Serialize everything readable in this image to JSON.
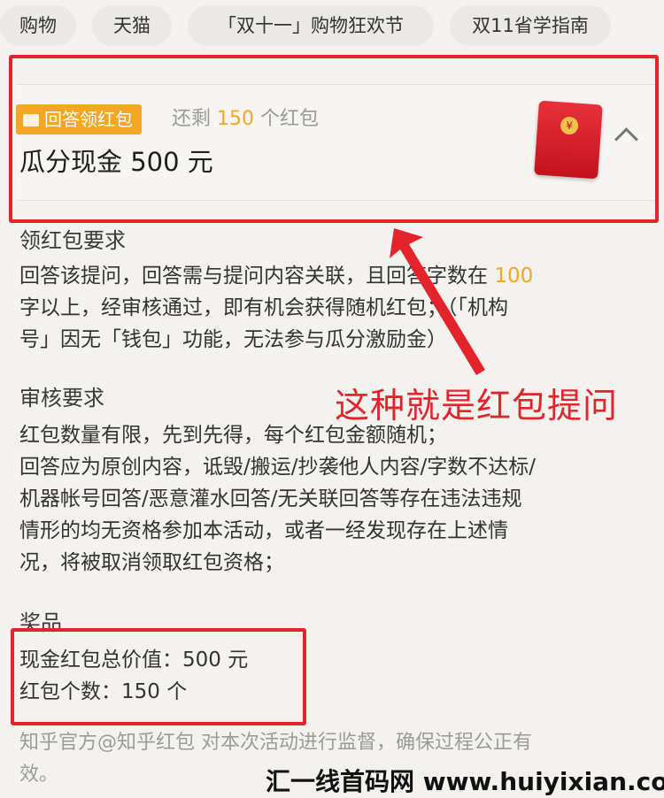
{
  "tags": [
    "购物",
    "天猫",
    "「双十一」购物狂欢节",
    "双11省学指南"
  ],
  "card": {
    "badge_label": "回答领红包",
    "remaining_prefix": "还剩",
    "remaining_count": "150",
    "remaining_suffix": "个红包",
    "headline": "瓜分现金 500 元",
    "envelope_icon": "red-envelope-icon",
    "collapse_icon": "chevron-up-icon"
  },
  "sections": {
    "requirements_title": "领红包要求",
    "requirements_line1_a": "回答该提问，回答需与提问内容关联，且回答字数在",
    "requirements_line1_num": "100",
    "requirements_line2": "字以上，经审核通过，即有机会获得随机红包；（「机构",
    "requirements_line3": "号」因无「钱包」功能，无法参与瓜分激励金）",
    "review_title": "审核要求",
    "review_line1": "红包数量有限，先到先得，每个红包金额随机；",
    "review_line2": "回答应为原创内容，诋毁/搬运/抄袭他人内容/字数不达标/",
    "review_line3": "机器帐号回答/恶意灌水回答/无关联回答等存在违法违规",
    "review_line4": "情形的均无资格参加本活动，或者一经发现存在上述情",
    "review_line5": "况，将被取消领取红包资格；",
    "prize_title": "奖品",
    "prize_line1": "现金红包总价值：500 元",
    "prize_line2": "红包个数：150 个",
    "footer_line1": "知乎官方@知乎红包 对本次活动进行监督，确保过程公正有",
    "footer_line2": "效。"
  },
  "annotation": "这种就是红包提问",
  "watermark": "汇一线首码网 www.huiyixian.com",
  "colors": {
    "accent": "#f5a623",
    "annotation_red": "#e3242b"
  }
}
